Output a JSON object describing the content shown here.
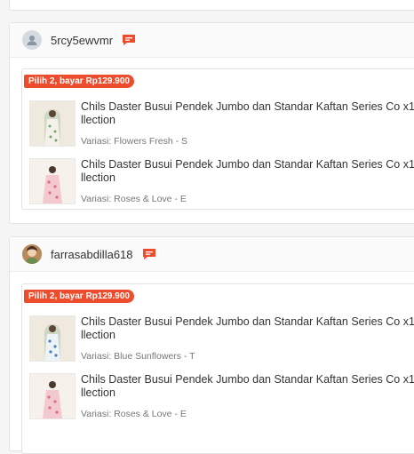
{
  "orders": [
    {
      "buyer": "5rcy5ewvmr",
      "avatar": "default-avatar",
      "promo": "Pilih 2, bayar Rp129.900",
      "items": [
        {
          "title": "Chils Daster Busui Pendek Jumbo dan Standar Kaftan Series Co x1 llection",
          "variant": "Variasi: Flowers Fresh - S"
        },
        {
          "title": "Chils Daster Busui Pendek Jumbo dan Standar Kaftan Series Co x1 llection",
          "variant": "Variasi: Roses & Love - E"
        }
      ]
    },
    {
      "buyer": "farrasabdilla618",
      "avatar": "photo-avatar",
      "promo": "Pilih 2, bayar Rp129.900",
      "items": [
        {
          "title": "Chils Daster Busui Pendek Jumbo dan Standar Kaftan Series Co x1 llection",
          "variant": "Variasi: Blue Sunflowers - T"
        },
        {
          "title": "Chils Daster Busui Pendek Jumbo dan Standar Kaftan Series Co x1 llection",
          "variant": "Variasi: Roses & Love - E"
        }
      ]
    }
  ],
  "colors": {
    "accent": "#ee4d2d",
    "border": "#e3e3e3"
  }
}
